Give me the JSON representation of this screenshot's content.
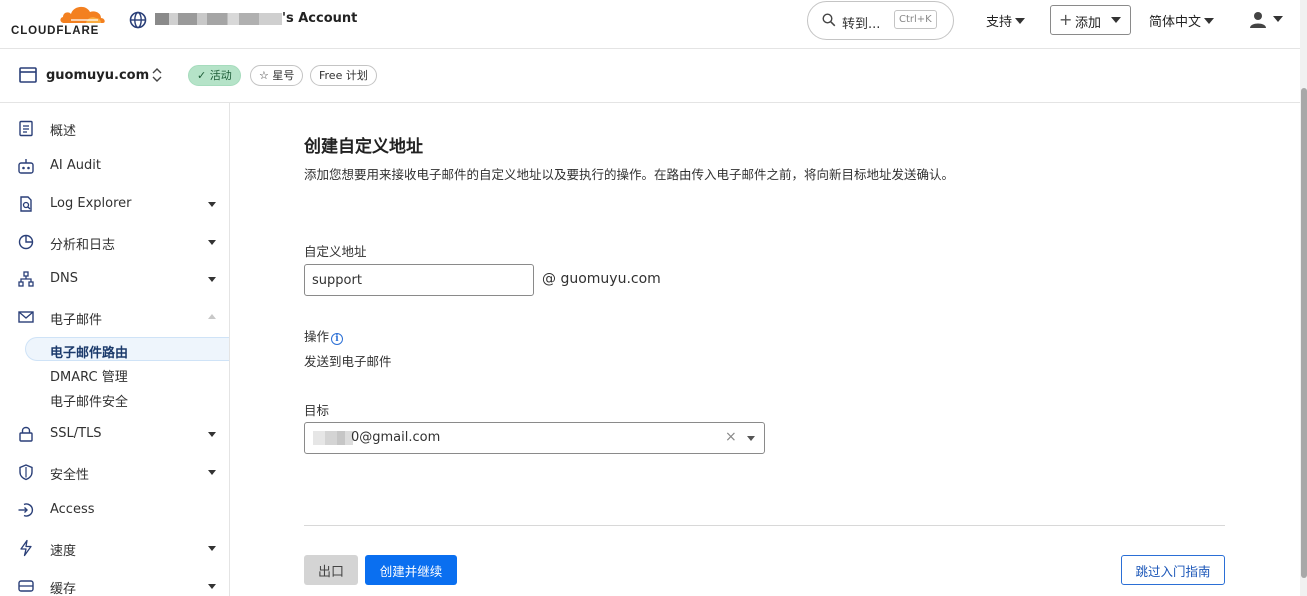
{
  "header": {
    "logo_text": "CLOUDFLARE",
    "account_suffix": "'s Account",
    "search_label": "转到...",
    "search_shortcut": "Ctrl+K",
    "support_label": "支持",
    "add_label": "添加",
    "language_label": "简体中文"
  },
  "zone": {
    "name": "guomuyu.com",
    "status_label": "活动",
    "star_label": "星号",
    "plan_label": "Free 计划"
  },
  "sidebar": {
    "items": [
      {
        "label": "概述",
        "icon": "clipboard-icon"
      },
      {
        "label": "AI Audit",
        "icon": "robot-icon"
      },
      {
        "label": "Log Explorer",
        "icon": "document-search-icon"
      },
      {
        "label": "分析和日志",
        "icon": "pie-chart-icon"
      },
      {
        "label": "DNS",
        "icon": "network-icon"
      },
      {
        "label": "电子邮件",
        "icon": "mail-icon"
      },
      {
        "label": "SSL/TLS",
        "icon": "lock-icon"
      },
      {
        "label": "安全性",
        "icon": "shield-icon"
      },
      {
        "label": "Access",
        "icon": "access-icon"
      },
      {
        "label": "速度",
        "icon": "bolt-icon"
      },
      {
        "label": "缓存",
        "icon": "cache-icon"
      }
    ],
    "email_subitems": [
      {
        "label": "电子邮件路由",
        "active": true
      },
      {
        "label": "DMARC 管理"
      },
      {
        "label": "电子邮件安全"
      }
    ]
  },
  "main": {
    "title": "创建自定义地址",
    "description": "添加您想要用来接收电子邮件的自定义地址以及要执行的操作。在路由传入电子邮件之前，将向新目标地址发送确认。",
    "custom_address_label": "自定义地址",
    "custom_address_value": "support",
    "at_domain": "@  guomuyu.com",
    "action_label": "操作",
    "action_value": "发送到电子邮件",
    "target_label": "目标",
    "target_value": "0@gmail.com",
    "exit_label": "出口",
    "create_label": "创建并继续",
    "skip_label": "跳过入门指南"
  },
  "colors": {
    "brand_orange": "#f38020",
    "primary_blue": "#0a6ff0",
    "active_green": "#b5e3c8"
  }
}
